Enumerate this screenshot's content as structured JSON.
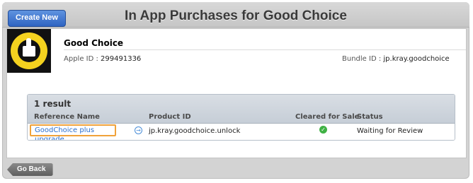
{
  "header": {
    "create_button": "Create New",
    "title": "In App Purchases for Good Choice"
  },
  "app": {
    "name": "Good Choice",
    "apple_id_label": "Apple ID :",
    "apple_id": "299491336",
    "bundle_id_label": "Bundle ID :",
    "bundle_id": "jp.kray.goodchoice",
    "icon_text": "GOOD CHOICE!!"
  },
  "results": {
    "count": "1 result",
    "columns": [
      "Reference Name",
      "Product ID",
      "Cleared for Sale",
      "Status"
    ],
    "rows": [
      {
        "reference_name": "GoodChoice plus upgrade",
        "product_id": "jp.kray.goodchoice.unlock",
        "cleared_for_sale": true,
        "status": "Waiting for Review"
      }
    ]
  },
  "footer": {
    "back_button": "Go Back"
  },
  "colors": {
    "accent": "#2f64c2",
    "link": "#2a6fcf",
    "highlight": "#f0a23a",
    "check": "#3fb144"
  }
}
